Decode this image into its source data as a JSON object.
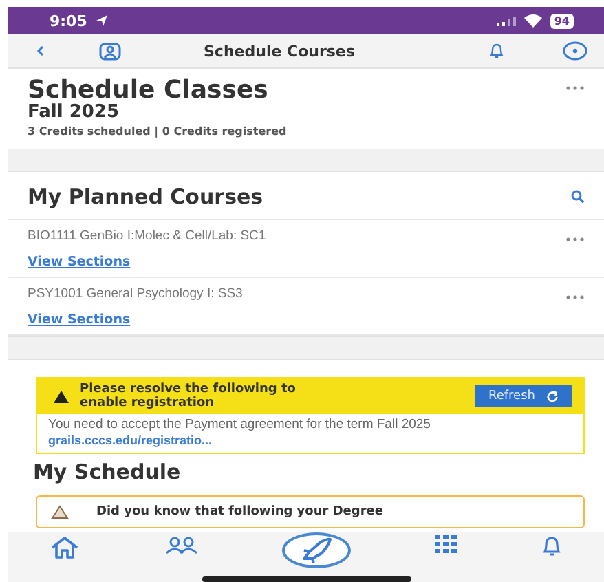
{
  "status_bar": {
    "time": "9:05",
    "battery": "94"
  },
  "nav_bar": {
    "title": "Schedule Courses"
  },
  "header": {
    "title": "Schedule Classes",
    "term": "Fall 2025",
    "credits": "3 Credits scheduled | 0 Credits registered"
  },
  "planned_courses": {
    "title": "My Planned Courses",
    "courses": [
      {
        "name": "BIO1111 GenBio I:Molec & Cell/Lab: SC1",
        "link": "View Sections"
      },
      {
        "name": "PSY1001 General Psychology I: SS3",
        "link": "View Sections"
      }
    ]
  },
  "registration_alert": {
    "title": "Please resolve the following to enable registration",
    "button": "Refresh",
    "message": "You need to accept the Payment agreement for the term Fall 2025",
    "link": "grails.cccs.edu/registratio..."
  },
  "schedule": {
    "title": "My Schedule",
    "tip": "Did you know that following your Degree"
  },
  "tab_bar": {
    "tabs": [
      {
        "kind": "home"
      },
      {
        "kind": "people"
      },
      {
        "kind": "rocket"
      },
      {
        "kind": "grid"
      },
      {
        "kind": "bell"
      }
    ]
  }
}
